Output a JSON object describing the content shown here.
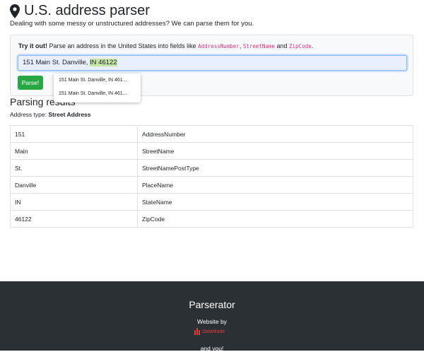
{
  "header": {
    "title": "U.S. address parser"
  },
  "intro": "Dealing with some messy or unstructured addresses? We can parse them for you.",
  "try_it": {
    "strong": "Try it out!",
    "text": " Parse an address in the United States into fields like ",
    "field1": "AddressNumber",
    "comma": ", ",
    "field2": "StreetName",
    "and": " and ",
    "field3": "ZipCode",
    "period": "."
  },
  "input": {
    "value_plain": "151 Main St. Danville, ",
    "value_highlight": "IN 46122"
  },
  "parse_button": "Parse!",
  "suggestions": [
    "151 Main St. Danville, IN 461...",
    "151 Main St. Danville, IN 461..."
  ],
  "results": {
    "title": "Parsing results",
    "type_label": "Address type: ",
    "type_value": "Street Address",
    "rows": [
      {
        "token": "151",
        "label": "AddressNumber"
      },
      {
        "token": "Main",
        "label": "StreetName"
      },
      {
        "token": "St.",
        "label": "StreetNamePostType"
      },
      {
        "token": "Danville",
        "label": "PlaceName"
      },
      {
        "token": "IN",
        "label": "StateName"
      },
      {
        "token": "46122",
        "label": "ZipCode"
      }
    ]
  },
  "footer": {
    "brand": "Parserator",
    "website_by": "Website by",
    "company": "DataMade",
    "and_you": "and you!"
  },
  "colors": {
    "accent_green": "#28a745",
    "footer_bg": "#2b3035",
    "code_pink": "#d63384"
  }
}
